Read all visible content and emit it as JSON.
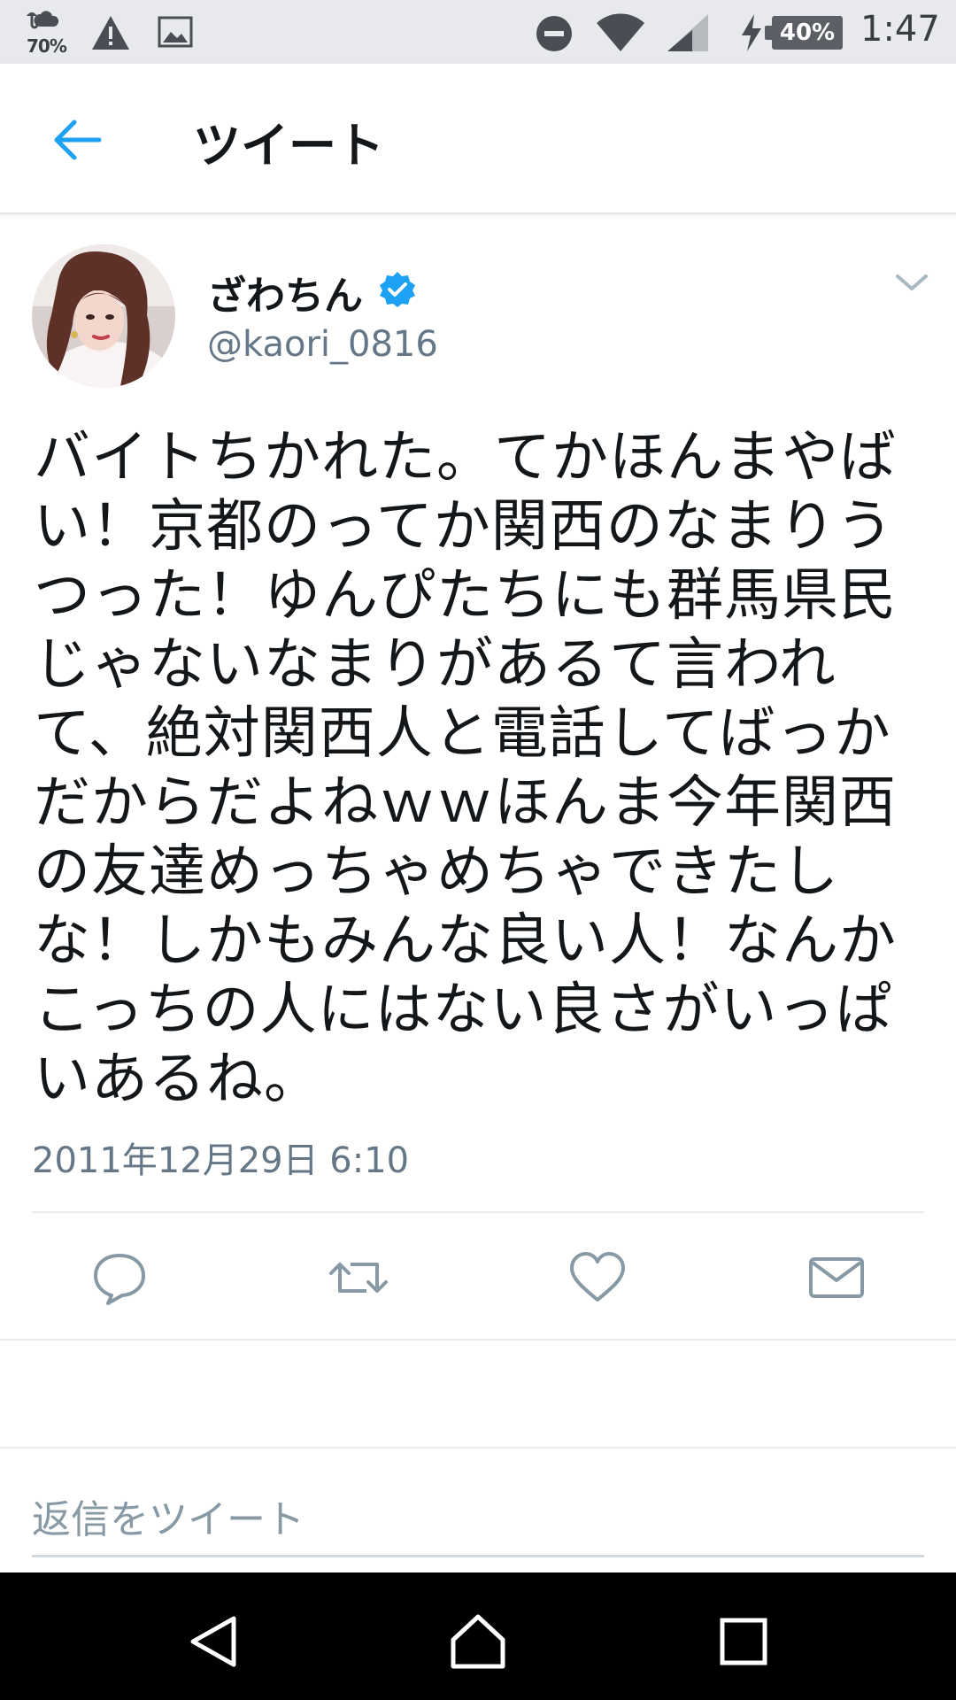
{
  "status_bar": {
    "weather_percent": "70%",
    "battery": "40%",
    "time": "1:47"
  },
  "header": {
    "title": "ツイート"
  },
  "tweet": {
    "display_name": "ざわちん",
    "handle": "@kaori_0816",
    "text": "バイトちかれた。てかほんまやばい！京都のってか関西のなまりうつった！ゆんぴたちにも群馬県民じゃないなまりがあるて言われて、絶対関西人と電話してばっかだからだよねｗｗほんま今年関西の友達めっちゃめちゃできたしな！しかもみんな良い人！なんかこっちの人にはない良さがいっぱいあるね。",
    "timestamp": "2011年12月29日 6:10"
  },
  "reply": {
    "placeholder": "返信をツイート"
  },
  "colors": {
    "accent": "#1da1f2",
    "text": "#14171a",
    "secondary": "#657786",
    "icon": "#8899a6"
  },
  "icons": [
    "back-arrow-icon",
    "verified-badge-icon",
    "chevron-down-icon",
    "reply-icon",
    "retweet-icon",
    "like-icon",
    "dm-icon"
  ]
}
